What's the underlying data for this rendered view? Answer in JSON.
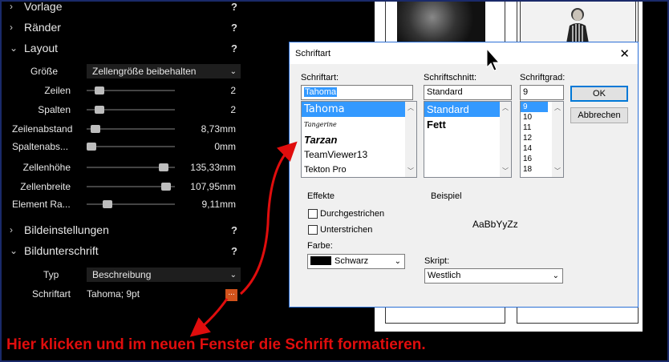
{
  "sections": {
    "vorlage": "Vorlage",
    "raender": "Ränder",
    "layout": "Layout",
    "bildeinstellungen": "Bildeinstellungen",
    "bildunterschrift": "Bildunterschrift",
    "help": "?"
  },
  "layout": {
    "groesse_label": "Größe",
    "groesse_value": "Zellengröße beibehalten",
    "sliders": [
      {
        "label": "Zeilen",
        "value": "2",
        "level": 0.1
      },
      {
        "label": "Spalten",
        "value": "2",
        "level": 0.1
      },
      {
        "label": "Zeilenabstand",
        "value": "8,73mm",
        "level": 0.05
      },
      {
        "label": "Spaltenabs...",
        "value": "0mm",
        "level": 0.0
      },
      {
        "label": "Zellenhöhe",
        "value": "135,33mm",
        "level": 0.92
      },
      {
        "label": "Zellenbreite",
        "value": "107,95mm",
        "level": 0.95
      },
      {
        "label": "Element Ra...",
        "value": "9,11mm",
        "level": 0.2
      }
    ]
  },
  "bildunterschrift": {
    "typ_label": "Typ",
    "typ_value": "Beschreibung",
    "schriftart_label": "Schriftart",
    "schriftart_value": "Tahoma; 9pt",
    "dots": "..."
  },
  "dialog": {
    "title": "Schriftart",
    "schriftart_label": "Schriftart:",
    "schriftart_value": "Tahoma",
    "fonts": [
      "Tahoma",
      "Tangerine",
      "Tarzan",
      "TeamViewer13",
      "Tekton Pro"
    ],
    "schnitt_label": "Schriftschnitt:",
    "schnitt_value": "Standard",
    "schnitte": [
      "Standard",
      "Fett"
    ],
    "grad_label": "Schriftgrad:",
    "grad_value": "9",
    "grade": [
      "9",
      "10",
      "11",
      "12",
      "14",
      "16",
      "18"
    ],
    "ok": "OK",
    "abbrechen": "Abbrechen",
    "effekte": "Effekte",
    "durchgestrichen": "Durchgestrichen",
    "unterstrichen": "Unterstrichen",
    "farbe_label": "Farbe:",
    "farbe_value": "Schwarz",
    "beispiel_label": "Beispiel",
    "beispiel_text": "AaBbYyZz",
    "skript_label": "Skript:",
    "skript_value": "Westlich"
  },
  "instruction": "Hier klicken und im neuen Fenster die Schrift formatieren.",
  "colors": {
    "accent_button": "#d2531c",
    "highlight": "#3399ff",
    "annotation_red": "#e00d0d"
  }
}
